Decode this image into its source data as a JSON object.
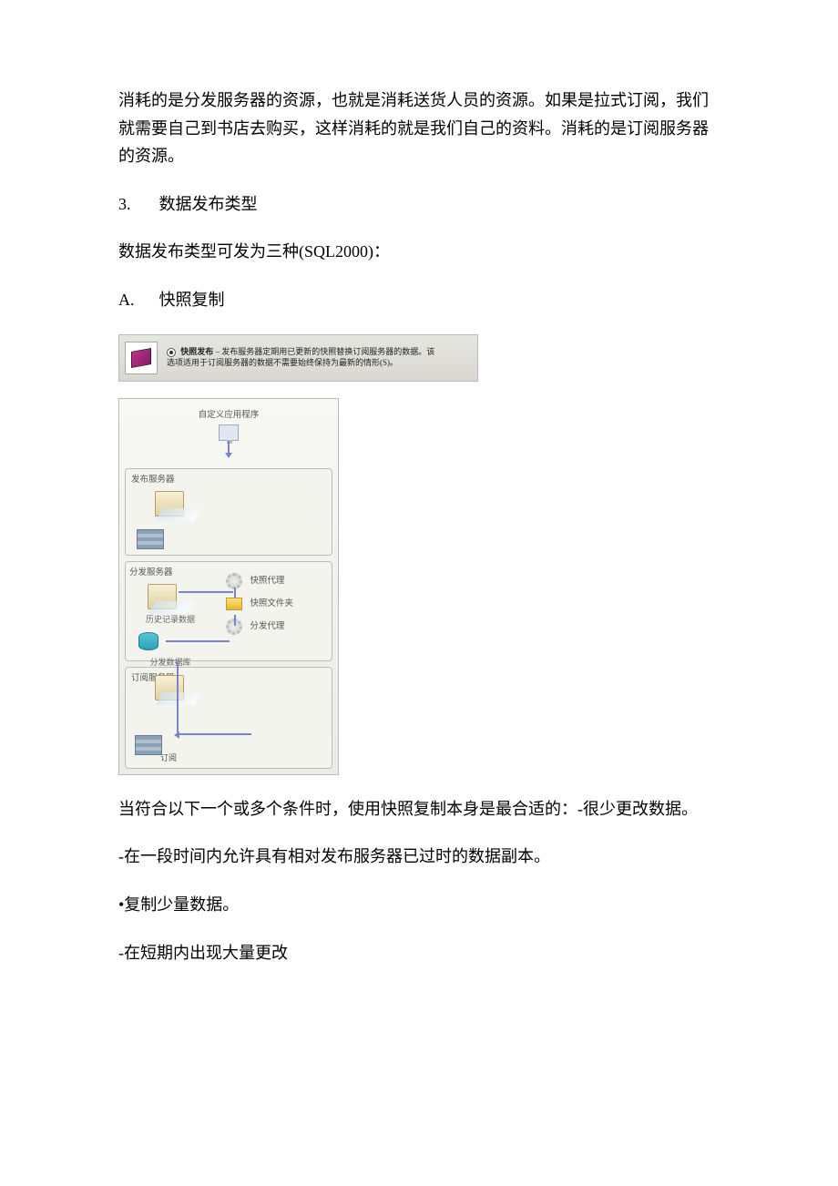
{
  "para1": "消耗的是分发服务器的资源，也就是消耗送货人员的资源。如果是拉式订阅，我们就需要自己到书店去购买，这样消耗的就是我们自己的资料。消耗的是订阅服务器的资源。",
  "list3_num": "3.",
  "list3_text": "数据发布类型",
  "para2": "数据发布类型可发为三种(SQL2000)：",
  "listA_num": "A.",
  "listA_text": "快照复制",
  "fig1": {
    "title": "快照发布",
    "desc_line1": " – 发布服务器定期用已更新的快照替换订阅服务器的数据。该",
    "desc_line2": "选项适用于订阅服务器的数据不需要始终保持为最新的情形(S)。"
  },
  "fig2": {
    "top_label": "自定义应用程序",
    "pub_label": "发布服务器",
    "dist_label": "分发服务器",
    "hist_label": "历史记录数据",
    "dist_db_label": "分发数据库",
    "snapshot_agent": "快照代理",
    "snapshot_folder": "快照文件夹",
    "dist_agent": "分发代理",
    "sub_label": "订阅服务器",
    "sub_caption": "订阅"
  },
  "para3": "当符合以下一个或多个条件时，使用快照复制本身是最合适的：-很少更改数据。",
  "bullet1": "-在一段时间内允许具有相对发布服务器已过时的数据副本。",
  "bullet2": "•复制少量数据。",
  "bullet3": "-在短期内出现大量更改"
}
